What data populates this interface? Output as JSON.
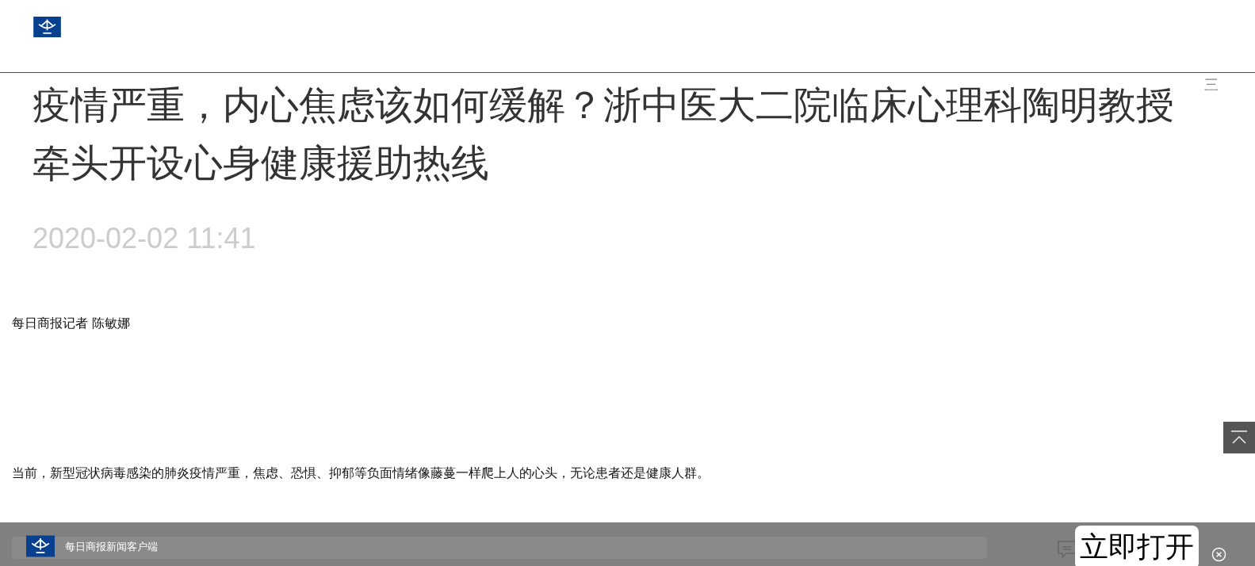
{
  "header": {
    "menu_icon": "三"
  },
  "article": {
    "title": "疫情严重，内心焦虑该如何缓解？浙中医大二院临床心理科陶明教授牵头开设心身健康援助热线",
    "date": "2020-02-02 11:41",
    "byline": "每日商报记者 陈敏娜",
    "paragraphs": [
      "当前，新型冠状病毒感染的肺炎疫情严重，焦虑、恐惧、抑郁等负面情绪像藤蔓一样爬上人的心头，无论患者还是健康人群。"
    ]
  },
  "app_banner": {
    "name": "每日商报新闻客户端",
    "open_button": "立即打开"
  }
}
